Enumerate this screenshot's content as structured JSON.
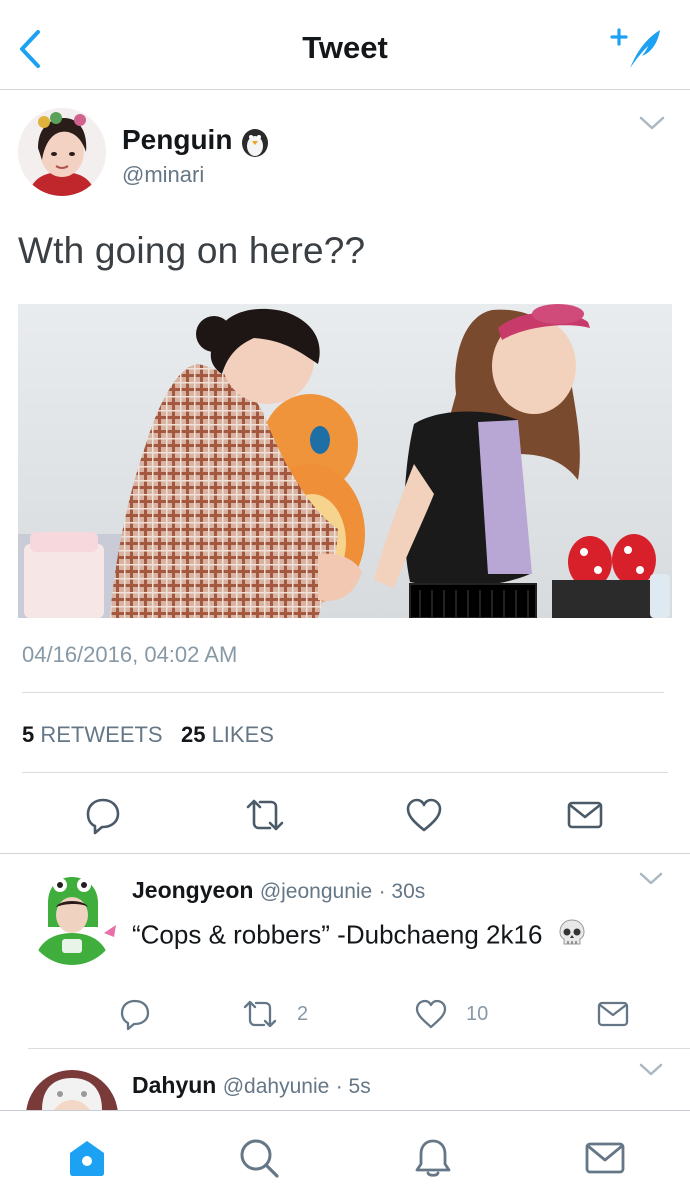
{
  "header": {
    "title": "Tweet",
    "back_icon": "chevron-left-icon",
    "compose_icon": "compose-tweet-icon",
    "accent": "#1da1f2"
  },
  "main_tweet": {
    "name": "Penguin",
    "name_emoji": "penguin-emoji",
    "handle": "@minari",
    "text": "Wth going on here??",
    "media_alt": "photo",
    "timestamp": "04/16/2016, 04:02 AM",
    "retweets_count": "5",
    "retweets_label": "RETWEETS",
    "likes_count": "25",
    "likes_label": "LIKES",
    "actions": [
      "reply-icon",
      "retweet-icon",
      "like-icon",
      "direct-message-icon"
    ]
  },
  "replies": [
    {
      "name": "Jeongyeon",
      "handle": "@jeongunie",
      "time": "· 30s",
      "text": "“Cops & robbers” -Dubchaeng 2k16",
      "emoji": "skull-emoji",
      "retweets": "2",
      "likes": "10"
    },
    {
      "name": "Dahyun",
      "handle": "@dahyunie",
      "time": "· 5s"
    }
  ],
  "tabbar": {
    "items": [
      "home-icon",
      "search-icon",
      "notifications-icon",
      "messages-icon"
    ],
    "active_color": "#1da1f2",
    "inactive_color": "#657786"
  }
}
